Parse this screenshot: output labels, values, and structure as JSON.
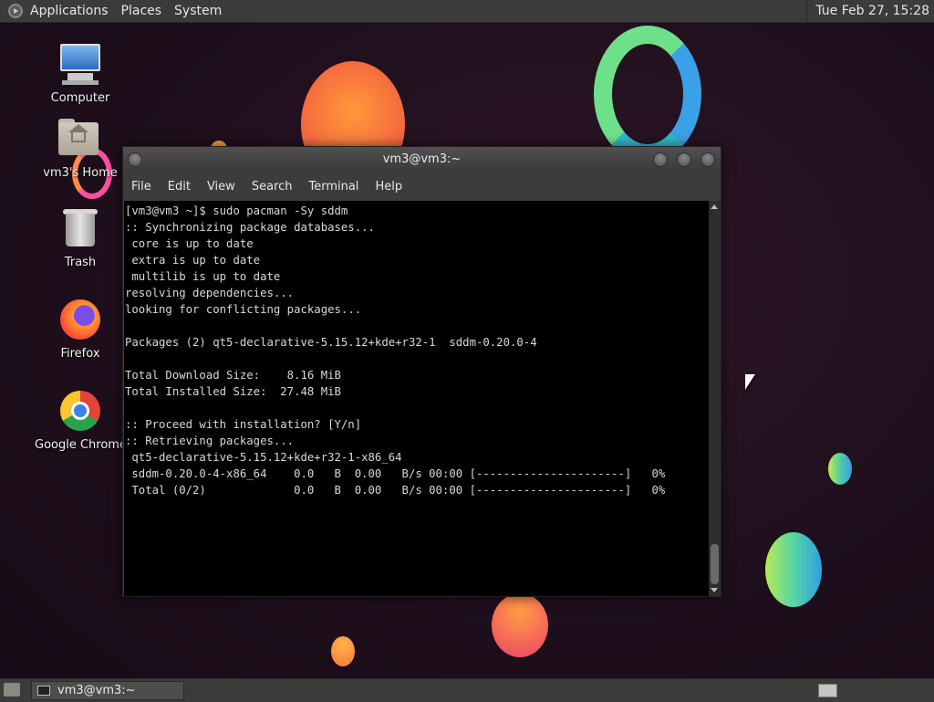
{
  "top_panel": {
    "menus": [
      "Applications",
      "Places",
      "System"
    ],
    "clock": "Tue Feb 27, 15:28"
  },
  "desktop_icons": [
    {
      "label": "Computer",
      "icon": "computer-icon"
    },
    {
      "label": "vm3's Home",
      "icon": "home-folder-icon"
    },
    {
      "label": "Trash",
      "icon": "trash-icon"
    },
    {
      "label": "Firefox",
      "icon": "firefox-icon"
    },
    {
      "label": "Google Chrome",
      "icon": "chrome-icon"
    }
  ],
  "terminal": {
    "title": "vm3@vm3:~",
    "menus": [
      "File",
      "Edit",
      "View",
      "Search",
      "Terminal",
      "Help"
    ],
    "lines": [
      "[vm3@vm3 ~]$ sudo pacman -Sy sddm",
      ":: Synchronizing package databases...",
      " core is up to date",
      " extra is up to date",
      " multilib is up to date",
      "resolving dependencies...",
      "looking for conflicting packages...",
      "",
      "Packages (2) qt5-declarative-5.15.12+kde+r32-1  sddm-0.20.0-4",
      "",
      "Total Download Size:    8.16 MiB",
      "Total Installed Size:  27.48 MiB",
      "",
      ":: Proceed with installation? [Y/n]",
      ":: Retrieving packages...",
      " qt5-declarative-5.15.12+kde+r32-1-x86_64",
      " sddm-0.20.0-4-x86_64    0.0   B  0.00   B/s 00:00 [----------------------]   0%",
      " Total (0/2)             0.0   B  0.00   B/s 00:00 [----------------------]   0%"
    ]
  },
  "taskbar": {
    "task_label": "vm3@vm3:~"
  }
}
